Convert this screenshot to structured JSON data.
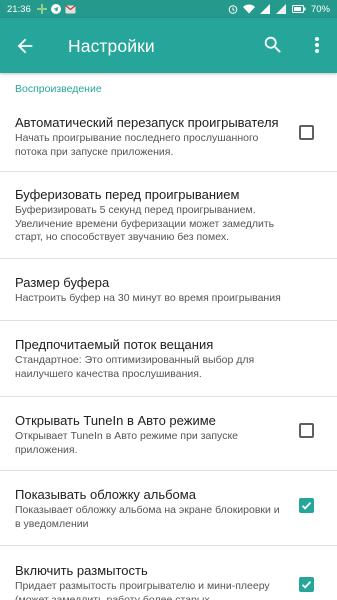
{
  "status_bar": {
    "time": "21:36",
    "battery": "70%"
  },
  "app_bar": {
    "title": "Настройки",
    "back_icon": "arrow-back-icon",
    "search_icon": "search-icon",
    "more_icon": "more-vert-icon"
  },
  "section": {
    "header": "Воспроизведение"
  },
  "settings": [
    {
      "title": "Автоматический перезапуск проигрывателя",
      "summary": "Начать проигрывание последнего прослушанного потока при запуске приложения.",
      "checkbox": true,
      "checked": false
    },
    {
      "title": "Буферизовать перед проигрыванием",
      "summary": "Буферизировать 5 секунд перед проигрыванием. Увеличение времени буферизации может замедлить старт, но способствует звучанию без помех.",
      "checkbox": false
    },
    {
      "title": "Размер буфера",
      "summary": "Настроить буфер на 30 минут во время проигрывания",
      "checkbox": false
    },
    {
      "title": "Предпочитаемый поток вещания",
      "summary": "Стандартное: Это оптимизированный выбор для наилучшего качества прослушивания.",
      "checkbox": false
    },
    {
      "title": "Открывать TuneIn в Авто режиме",
      "summary": "Открывает TuneIn в Авто режиме при запуске приложения.",
      "checkbox": true,
      "checked": false
    },
    {
      "title": "Показывать обложку альбома",
      "summary": "Показывает обложку альбома на экране блокировки и в уведомлении",
      "checkbox": true,
      "checked": true
    },
    {
      "title": "Включить размытость",
      "summary": "Придает размытость проигрывателю и мини-плееру (может замедлить работу более старых",
      "checkbox": true,
      "checked": true
    }
  ],
  "colors": {
    "accent": "#26a69a",
    "status_bar": "#24998c"
  }
}
